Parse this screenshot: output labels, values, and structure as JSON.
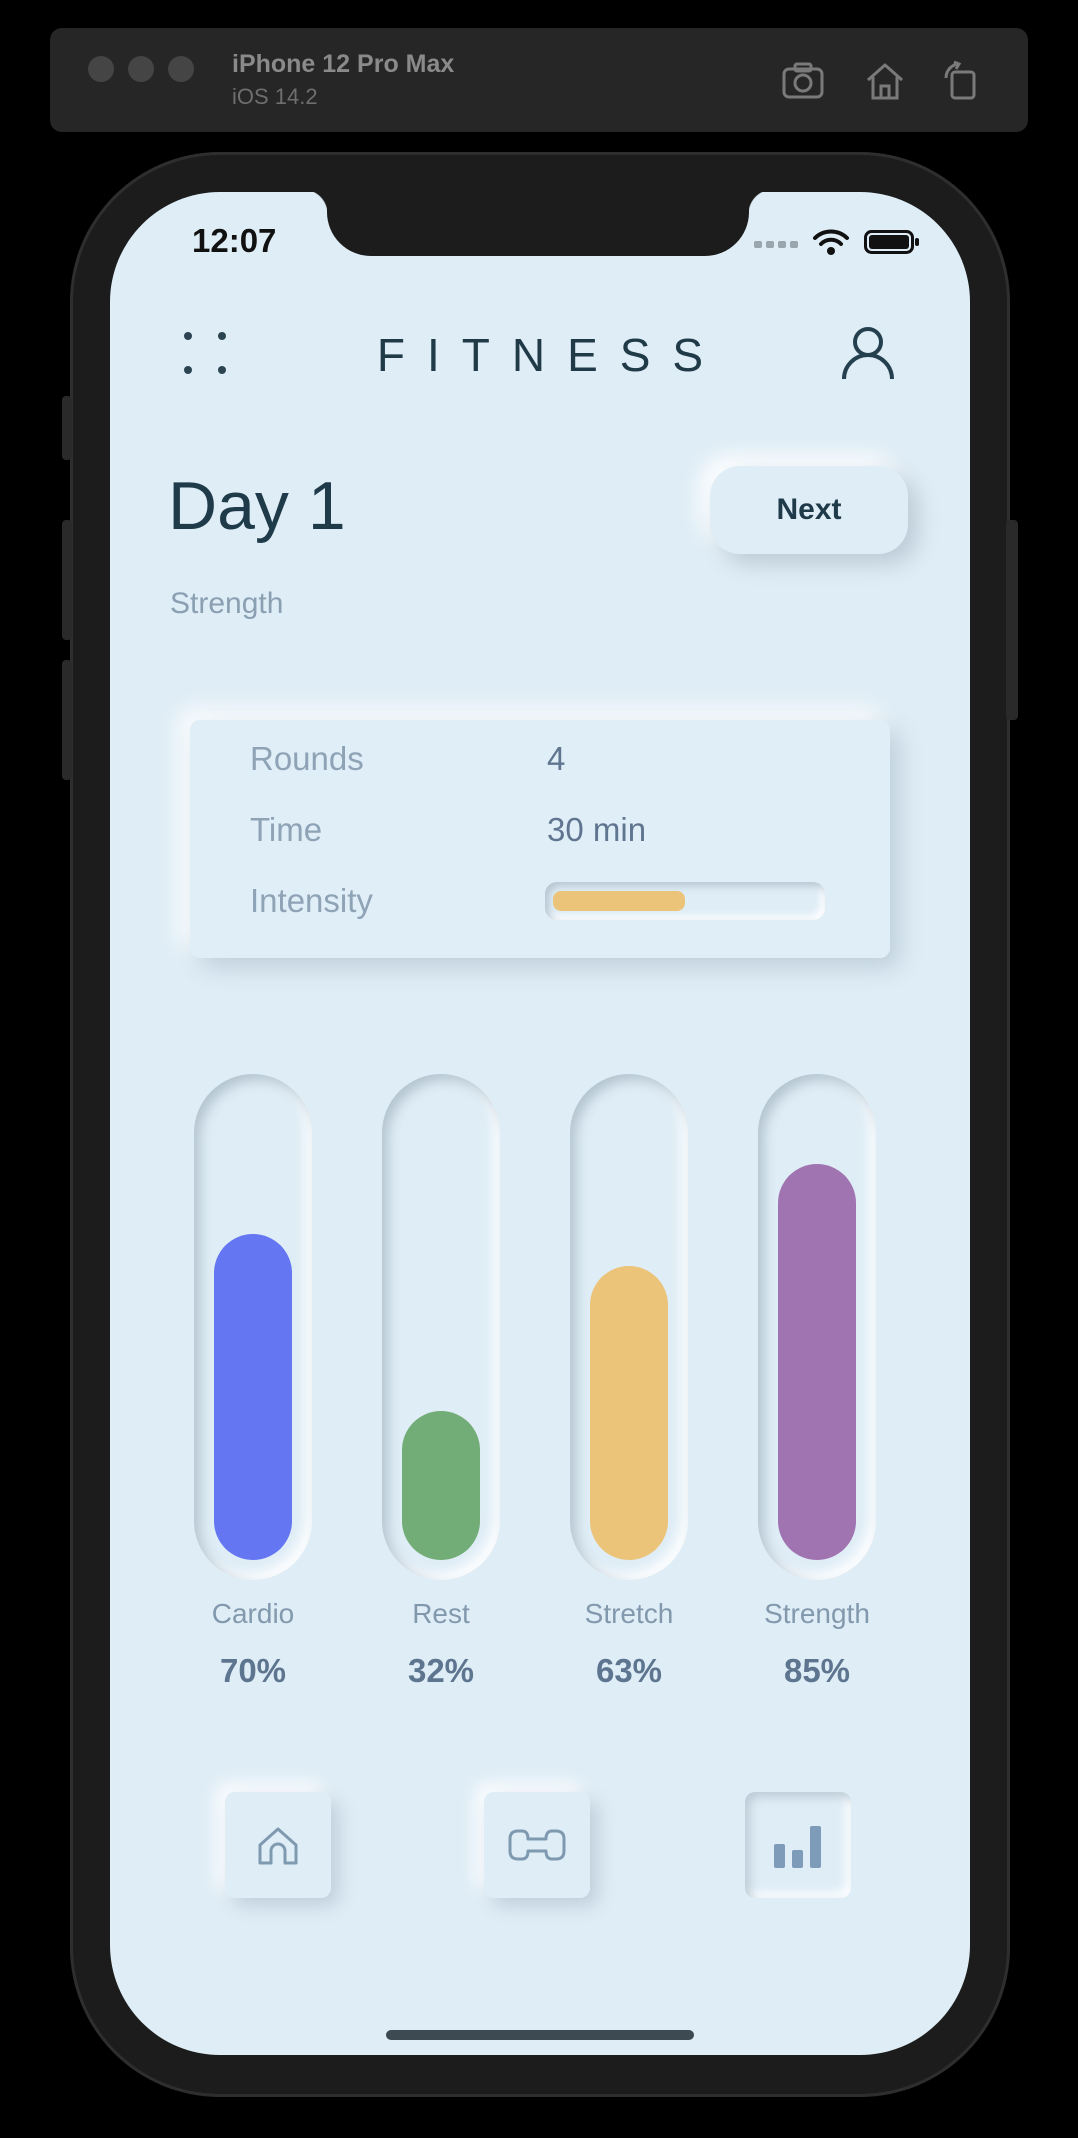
{
  "simulator": {
    "device_name": "iPhone 12 Pro Max",
    "os_version": "iOS 14.2"
  },
  "status_bar": {
    "time": "12:07"
  },
  "header": {
    "brand": "FITNESS"
  },
  "workout": {
    "title": "Day 1",
    "subtitle": "Strength",
    "next_label": "Next"
  },
  "details": {
    "rounds_label": "Rounds",
    "rounds_value": "4",
    "time_label": "Time",
    "time_value": "30 min",
    "intensity_label": "Intensity",
    "intensity_level": 0.5
  },
  "activity": [
    {
      "label": "Cardio",
      "percent_text": "70%",
      "value": 70,
      "color": "#6576f3"
    },
    {
      "label": "Rest",
      "percent_text": "32%",
      "value": 32,
      "color": "#72ad78"
    },
    {
      "label": "Stretch",
      "percent_text": "63%",
      "value": 63,
      "color": "#ebc479"
    },
    {
      "label": "Strength",
      "percent_text": "85%",
      "value": 85,
      "color": "#a073b1"
    }
  ],
  "bottom_nav": [
    {
      "icon": "home-icon",
      "active": false
    },
    {
      "icon": "dumbbell-icon",
      "active": false
    },
    {
      "icon": "bar-chart-icon",
      "active": true
    }
  ],
  "colors": {
    "background": "#dfedf6",
    "primary_text": "#1f3b4a",
    "intensity": "#ebc479"
  }
}
